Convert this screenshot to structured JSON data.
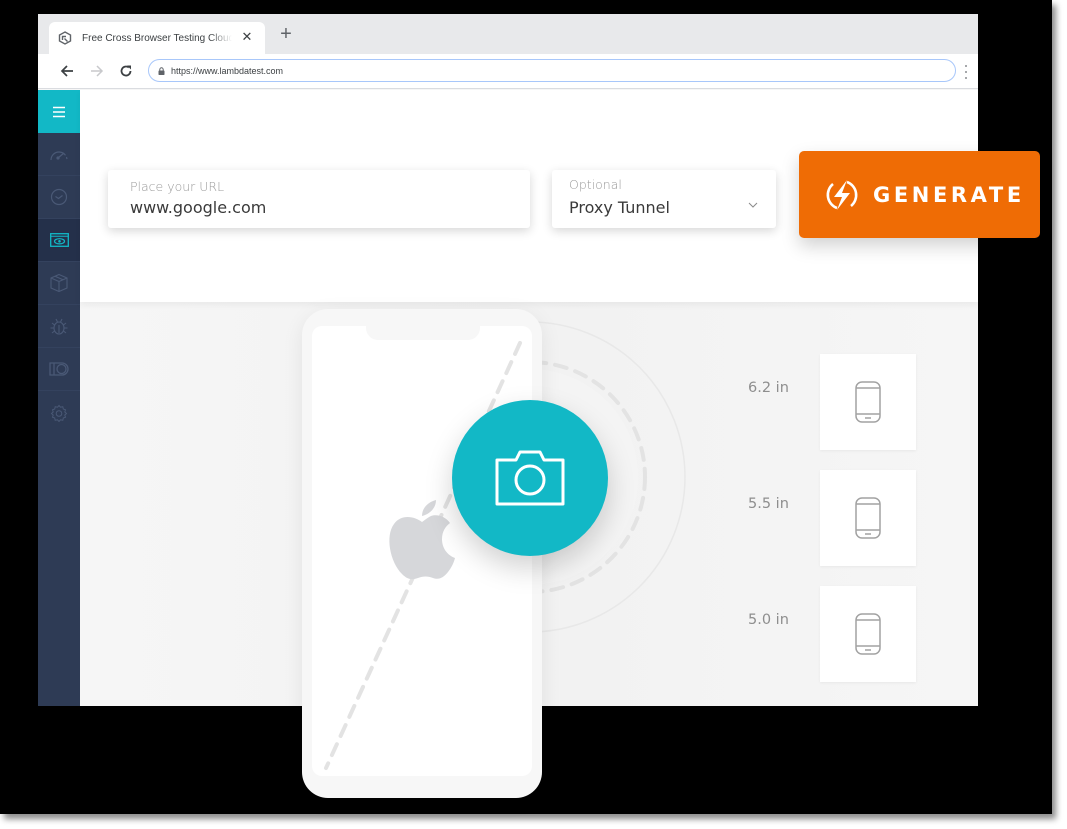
{
  "browser": {
    "tab_title": "Free Cross Browser Testing Cloud",
    "new_tab_label": "+",
    "close_tab_label": "✕",
    "url": "https://www.lambdatest.com",
    "icons": {
      "tab_favicon": "lambdatest-logo-icon",
      "back": "arrow-left-icon",
      "forward": "arrow-right-icon",
      "reload": "reload-icon",
      "lock": "lock-icon",
      "menu": "kebab-menu-icon"
    }
  },
  "sidebar": {
    "accent_color": "#12b8c6",
    "background_color": "#2e3b55",
    "items": [
      {
        "name": "menu",
        "icon": "hamburger-icon"
      },
      {
        "name": "dashboard",
        "icon": "speedometer-icon"
      },
      {
        "name": "history",
        "icon": "clock-icon"
      },
      {
        "name": "visual-testing",
        "icon": "browser-eye-icon",
        "active": true
      },
      {
        "name": "automation",
        "icon": "box-icon"
      },
      {
        "name": "issues",
        "icon": "bug-icon"
      },
      {
        "name": "integrations",
        "icon": "toggle-icon"
      },
      {
        "name": "settings",
        "icon": "gear-icon"
      }
    ]
  },
  "form": {
    "url_field": {
      "label": "Place your URL",
      "value": "www.google.com"
    },
    "tunnel_select": {
      "label": "Optional",
      "value": "Proxy Tunnel"
    },
    "generate_button": {
      "label": "GENERATE",
      "color": "#ef6c05",
      "icon": "lightning-icon"
    }
  },
  "preview": {
    "capture_button": {
      "icon": "camera-icon",
      "color": "#12b8c6"
    },
    "phone_logo": "apple-logo-icon",
    "device_sizes": [
      {
        "label": "6.2 in",
        "icon": "smartphone-icon"
      },
      {
        "label": "5.5 in",
        "icon": "smartphone-icon"
      },
      {
        "label": "5.0 in",
        "icon": "smartphone-icon"
      }
    ]
  }
}
